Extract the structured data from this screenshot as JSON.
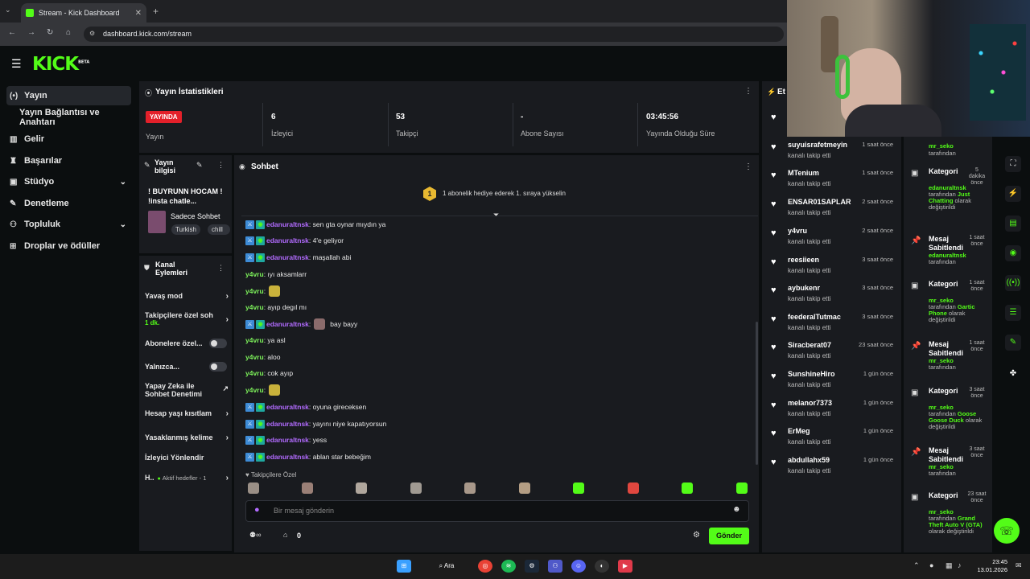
{
  "browser": {
    "tab_title": "Stream - Kick Dashboard",
    "url": "dashboard.kick.com/stream"
  },
  "brand": {
    "logo": "KICK",
    "beta": "BETA",
    "accent": "#53fc18"
  },
  "sidebar": {
    "items": [
      {
        "label": "Yayın",
        "icon": "broadcast-icon"
      },
      {
        "label": "Yayın Bağlantısı ve Anahtarı",
        "icon": ""
      },
      {
        "label": "Gelir",
        "icon": "chart-icon"
      },
      {
        "label": "Başarılar",
        "icon": "trophy-icon"
      },
      {
        "label": "Stüdyo",
        "icon": "studio-icon"
      },
      {
        "label": "Denetleme",
        "icon": "wrench-icon"
      },
      {
        "label": "Topluluk",
        "icon": "people-icon"
      },
      {
        "label": "Droplar ve ödüller",
        "icon": "gift-icon"
      }
    ]
  },
  "stats": {
    "title": "Yayın İstatistikleri",
    "live_badge": "YAYINDA",
    "live_label": "Yayın",
    "viewers": {
      "value": "6",
      "label": "İzleyici"
    },
    "followers": {
      "value": "53",
      "label": "Takipçi"
    },
    "subs": {
      "value": "-",
      "label": "Abone Sayısı"
    },
    "uptime": {
      "value": "03:45:56",
      "label": "Yayında Olduğu Süre"
    }
  },
  "stream_info": {
    "title": "Yayın bilgisi",
    "stream_title": "! BUYRUNN HOCAM ! !insta chatle...",
    "category": "Sadece Sohbet",
    "tags": [
      "Turkish",
      "chill"
    ]
  },
  "chat": {
    "title": "Sohbet",
    "gift_rank": "1",
    "gift_text": "1 abonelik hediye ederek 1. sıraya yükselin",
    "messages": [
      {
        "user": "edanuraltnsk",
        "text": ": sen gta oynar mıydın ya",
        "badges": true,
        "color": "purple"
      },
      {
        "user": "edanuraltnsk",
        "text": ": 4'e geliyor",
        "badges": true,
        "color": "purple"
      },
      {
        "user": "edanuraltnsk",
        "text": ": maşallah abi",
        "badges": true,
        "color": "purple"
      },
      {
        "user": "y4vru",
        "text": ": ıyı aksamlarr",
        "badges": false,
        "color": "green"
      },
      {
        "user": "y4vru",
        "text": ":",
        "badges": false,
        "color": "green",
        "emote": true
      },
      {
        "user": "y4vru",
        "text": ": ayıp degıl mı",
        "badges": false,
        "color": "green"
      },
      {
        "user": "edanuraltnsk",
        "text": "bay bayy",
        "badges": true,
        "color": "purple",
        "emote2": true
      },
      {
        "user": "y4vru",
        "text": ": ya asl",
        "badges": false,
        "color": "green"
      },
      {
        "user": "y4vru",
        "text": ": aloo",
        "badges": false,
        "color": "green"
      },
      {
        "user": "y4vru",
        "text": ": cok ayıp",
        "badges": false,
        "color": "green"
      },
      {
        "user": "y4vru",
        "text": ":",
        "badges": false,
        "color": "green",
        "emote": true
      },
      {
        "user": "edanuraltnsk",
        "text": ": oyuna gireceksen",
        "badges": true,
        "color": "purple"
      },
      {
        "user": "edanuraltnsk",
        "text": ": yayını niye kapatıyorsun",
        "badges": true,
        "color": "purple"
      },
      {
        "user": "edanuraltnsk",
        "text": ": yess",
        "badges": true,
        "color": "purple"
      },
      {
        "user": "edanuraltnsk",
        "text": ": ablan star bebeğim",
        "badges": true,
        "color": "purple"
      }
    ],
    "followers_only_label": "Takipçilere Özel",
    "input_placeholder": "Bir mesaj gönderin",
    "points": "0",
    "send_label": "Gönder"
  },
  "actions": {
    "title": "Kanal Eylemleri",
    "items": [
      {
        "label": "Yavaş mod",
        "control": "arrow"
      },
      {
        "label": "Takipçilere özel soh",
        "sub": "1 dk.",
        "control": "arrow"
      },
      {
        "label": "Abonelere özel...",
        "control": "toggle"
      },
      {
        "label": "Yalnızca...",
        "control": "toggle"
      },
      {
        "label": "Yapay Zeka ile Sohbet Denetimi",
        "control": "external"
      },
      {
        "label": "Hesap yaşı kısıtlam",
        "control": "arrow"
      },
      {
        "label": "Yasaklanmış kelime",
        "control": "arrow"
      },
      {
        "label": "İzleyici Yönlendir",
        "control": "none"
      },
      {
        "label": "H..",
        "sub": "Aktif hedefler - 1",
        "control": "arrow"
      }
    ]
  },
  "events": {
    "title": "Et",
    "items": [
      {
        "name": "suyuisrafetmeyin",
        "sub": "kanalı takip etti",
        "time": "1 saat önce"
      },
      {
        "name": "MTenium",
        "sub": "kanalı takip etti",
        "time": "1 saat önce"
      },
      {
        "name": "ENSAR01SAPLAR",
        "sub": "kanalı takip etti",
        "time": "2 saat önce"
      },
      {
        "name": "y4vru",
        "sub": "kanalı takip etti",
        "time": "2 saat önce"
      },
      {
        "name": "reesiieen",
        "sub": "kanalı takip etti",
        "time": "3 saat önce"
      },
      {
        "name": "aybukenr",
        "sub": "kanalı takip etti",
        "time": "3 saat önce"
      },
      {
        "name": "feederalTutmac",
        "sub": "kanalı takip etti",
        "time": "3 saat önce"
      },
      {
        "name": "Siracberat07",
        "sub": "kanalı takip etti",
        "time": "23 saat önce"
      },
      {
        "name": "SunshineHiro",
        "sub": "kanalı takip etti",
        "time": "1 gün önce"
      },
      {
        "name": "melanor7373",
        "sub": "kanalı takip etti",
        "time": "1 gün önce"
      },
      {
        "name": "ErMeg",
        "sub": "kanalı takip etti",
        "time": "1 gün önce"
      },
      {
        "name": "abdullahx59",
        "sub": "kanalı takip etti",
        "time": "1 gün önce"
      }
    ]
  },
  "activity": {
    "top": {
      "user": "mr_seko",
      "suffix": "tarafından"
    },
    "items": [
      {
        "title": "Kategori",
        "time": "5 dakika önce",
        "user": "edanuraltnsk",
        "mid": "tarafından",
        "value": "Just Chatting",
        "end": "olarak değiştirildi"
      },
      {
        "title": "Mesaj Sabitlendi",
        "time": "1 saat önce",
        "user": "edanuraltnsk",
        "mid": "tarafından",
        "value": "",
        "end": ""
      },
      {
        "title": "Kategori",
        "time": "1 saat önce",
        "user": "mr_seko",
        "mid": "tarafından",
        "value": "Gartic Phone",
        "end": "olarak değiştirildi"
      },
      {
        "title": "Mesaj Sabitlendi",
        "time": "1 saat önce",
        "user": "mr_seko",
        "mid": "tarafından",
        "value": "",
        "end": ""
      },
      {
        "title": "Kategori",
        "time": "3 saat önce",
        "user": "mr_seko",
        "mid": "tarafından",
        "value": "Goose Goose Duck",
        "end": "olarak değiştirildi"
      },
      {
        "title": "Mesaj Sabitlendi",
        "time": "3 saat önce",
        "user": "mr_seko",
        "mid": "tarafından",
        "value": "",
        "end": ""
      },
      {
        "title": "Kategori",
        "time": "23 saat önce",
        "user": "mr_seko",
        "mid": "tarafından",
        "value": "Grand Theft Auto V (GTA)",
        "end": "olarak değiştirildi"
      }
    ]
  },
  "taskbar": {
    "search": "Ara",
    "time": "23:45",
    "date": "13.01.2026"
  }
}
